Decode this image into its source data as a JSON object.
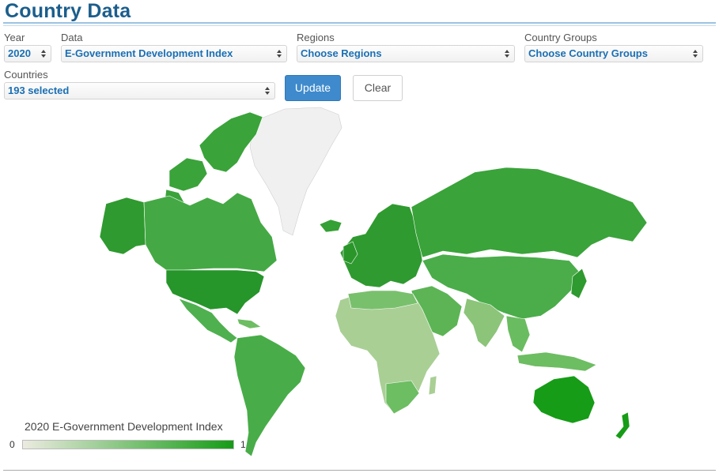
{
  "header": {
    "title": "Country Data"
  },
  "filters": {
    "year": {
      "label": "Year",
      "value": "2020"
    },
    "data": {
      "label": "Data",
      "value": "E-Government Development Index"
    },
    "regions": {
      "label": "Regions",
      "value": "Choose Regions"
    },
    "groups": {
      "label": "Country Groups",
      "value": "Choose Country Groups"
    },
    "countries": {
      "label": "Countries",
      "value": "193 selected"
    }
  },
  "buttons": {
    "update": "Update",
    "clear": "Clear"
  },
  "legend": {
    "title": "2020 E-Government Development Index",
    "min": "0",
    "max": "1",
    "color_low": "#ecebe0",
    "color_high": "#169c16"
  },
  "colors": {
    "title": "#1b5e8c",
    "select_text": "#1a6fb3",
    "button": "#3e8acc",
    "high": "#2f9a2f",
    "mid": "#4fb04f",
    "low": "#a9cf95",
    "lowest": "#d8e4c8",
    "nodata": "#f0f0f0"
  }
}
